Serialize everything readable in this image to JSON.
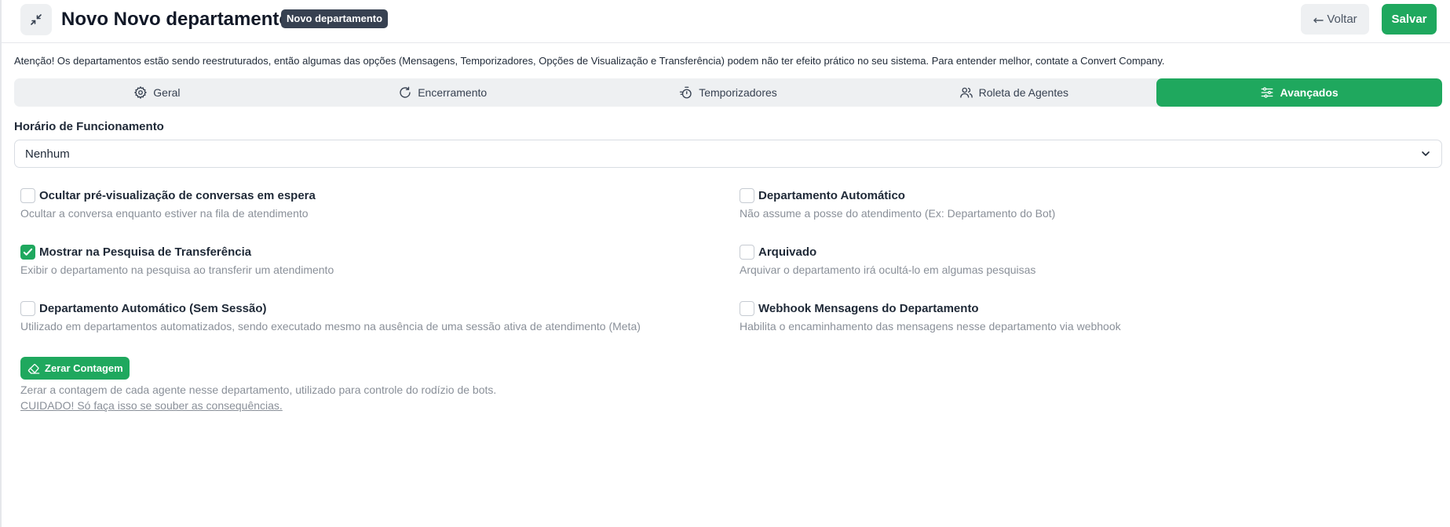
{
  "header": {
    "title": "Novo Novo departamento",
    "badge": "Novo departamento",
    "back_label": "Voltar",
    "save_label": "Salvar"
  },
  "notice": "Atenção! Os departamentos estão sendo reestruturados, então algumas das opções (Mensagens, Temporizadores, Opções de Visualização e Transferência) podem não ter efeito prático no seu sistema. Para entender melhor, contate a Convert Company.",
  "tabs": [
    {
      "label": "Geral",
      "icon": "gear-icon",
      "active": false
    },
    {
      "label": "Encerramento",
      "icon": "rotate-icon",
      "active": false
    },
    {
      "label": "Temporizadores",
      "icon": "timer-icon",
      "active": false
    },
    {
      "label": "Roleta de Agentes",
      "icon": "users-icon",
      "active": false
    },
    {
      "label": "Avançados",
      "icon": "sliders-icon",
      "active": true
    }
  ],
  "working_hours": {
    "label": "Horário de Funcionamento",
    "value": "Nenhum"
  },
  "options": [
    {
      "title": "Ocultar pré-visualização de conversas em espera",
      "description": "Ocultar a conversa enquanto estiver na fila de atendimento",
      "checked": false
    },
    {
      "title": "Departamento Automático",
      "description": "Não assume a posse do atendimento (Ex: Departamento do Bot)",
      "checked": false
    },
    {
      "title": "Mostrar na Pesquisa de Transferência",
      "description": "Exibir o departamento na pesquisa ao transferir um atendimento",
      "checked": true
    },
    {
      "title": "Arquivado",
      "description": "Arquivar o departamento irá ocultá-lo em algumas pesquisas",
      "checked": false
    },
    {
      "title": "Departamento Automático (Sem Sessão)",
      "description": "Utilizado em departamentos automatizados, sendo executado mesmo na ausência de uma sessão ativa de atendimento (Meta)",
      "checked": false
    },
    {
      "title": "Webhook Mensagens do Departamento",
      "description": "Habilita o encaminhamento das mensagens nesse departamento via webhook",
      "checked": false
    }
  ],
  "reset": {
    "button_label": "Zerar Contagem",
    "description": "Zerar a contagem de cada agente nesse departamento, utilizado para controle do rodízio de bots.",
    "warning": "CUIDADO! Só faça isso se souber as consequências."
  },
  "colors": {
    "accent": "#1fa85e",
    "badge_bg": "#374151",
    "muted_text": "#8a9099"
  }
}
